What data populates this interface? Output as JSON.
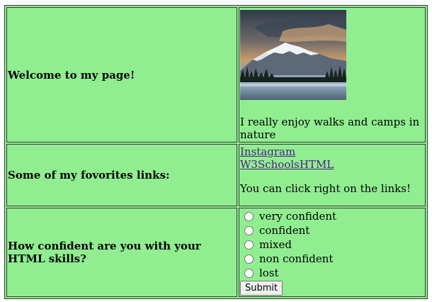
{
  "rows": {
    "welcome": {
      "heading": "Welcome to my page!",
      "caption": "I really enjoy walks and camps in nature",
      "image": "mountain-lake-landscape"
    },
    "links": {
      "heading": "Some of my fovorites links:",
      "items": [
        {
          "label": "Instagram"
        },
        {
          "label": "W3SchoolsHTML"
        }
      ],
      "note": "You can click right on the links!"
    },
    "skills": {
      "heading": "How confident are you with your HTML skills?",
      "options": [
        {
          "label": "very confident"
        },
        {
          "label": "confident"
        },
        {
          "label": "mixed"
        },
        {
          "label": "non confident"
        },
        {
          "label": "lost"
        }
      ],
      "submit_label": "Submit"
    }
  },
  "colors": {
    "cell_background": "#90ee90",
    "link": "#551a8b",
    "border": "#3a3a3a"
  }
}
